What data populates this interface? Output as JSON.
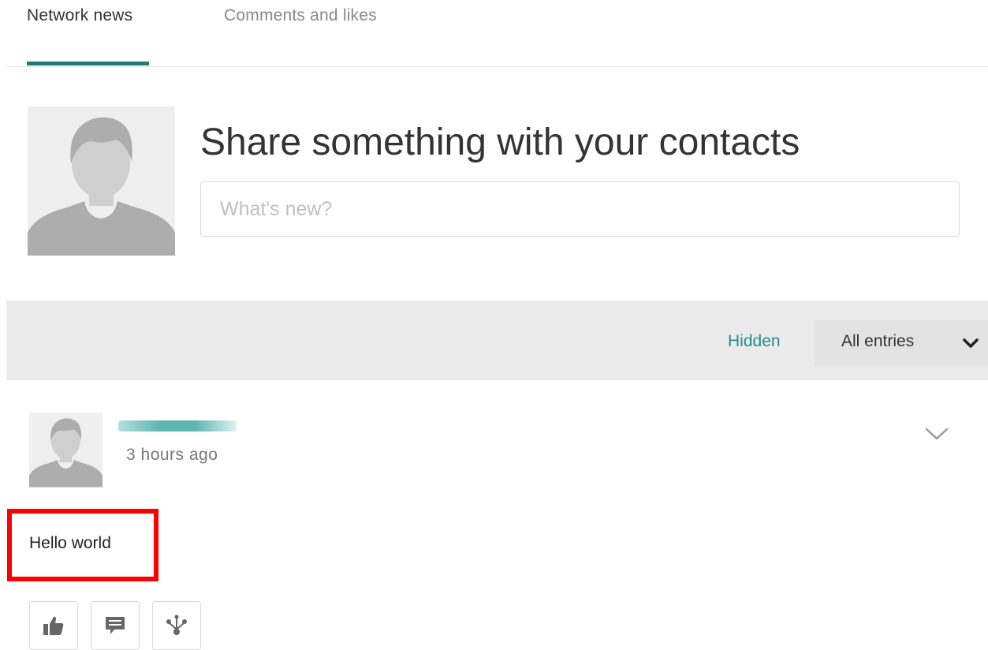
{
  "tabs": [
    {
      "label": "Network news",
      "active": true
    },
    {
      "label": "Comments and likes",
      "active": false
    }
  ],
  "composer": {
    "title": "Share something with your contacts",
    "placeholder": "What's new?",
    "value": ""
  },
  "filter": {
    "hidden_label": "Hidden",
    "select_value": "All entries"
  },
  "post": {
    "author": "",
    "time": "3 hours ago",
    "text": "Hello world",
    "actions": [
      {
        "icon": "thumbs-up-icon"
      },
      {
        "icon": "comment-icon"
      },
      {
        "icon": "share-icon"
      }
    ]
  },
  "colors": {
    "accent": "#1f7a78",
    "link": "#1f8f8c",
    "highlight": "#ff0000",
    "filter_bar": "#ebebeb"
  }
}
